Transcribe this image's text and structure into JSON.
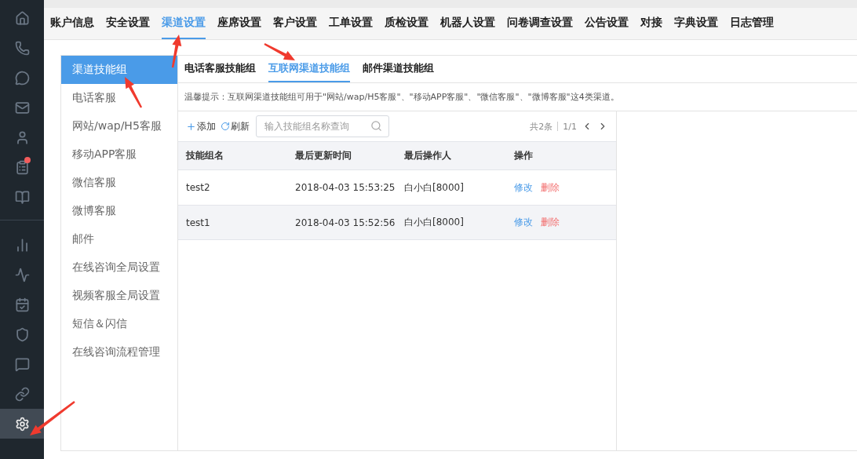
{
  "sidebar": {
    "top_items": [
      {
        "selected": false,
        "badge": false
      },
      {
        "selected": false,
        "badge": false
      },
      {
        "selected": false,
        "badge": false
      },
      {
        "selected": false,
        "badge": false
      },
      {
        "selected": false,
        "badge": false
      },
      {
        "selected": false,
        "badge": true
      },
      {
        "selected": false,
        "badge": false
      }
    ],
    "bottom_items": [
      {
        "selected": false,
        "badge": false
      },
      {
        "selected": false,
        "badge": false
      },
      {
        "selected": false,
        "badge": false
      },
      {
        "selected": false,
        "badge": false
      },
      {
        "selected": false,
        "badge": false
      },
      {
        "selected": false,
        "badge": false
      },
      {
        "selected": true,
        "badge": false
      }
    ]
  },
  "tabs": [
    {
      "label": "账户信息",
      "selected": false
    },
    {
      "label": "安全设置",
      "selected": false
    },
    {
      "label": "渠道设置",
      "selected": true
    },
    {
      "label": "座席设置",
      "selected": false
    },
    {
      "label": "客户设置",
      "selected": false
    },
    {
      "label": "工单设置",
      "selected": false
    },
    {
      "label": "质检设置",
      "selected": false
    },
    {
      "label": "机器人设置",
      "selected": false
    },
    {
      "label": "问卷调查设置",
      "selected": false
    },
    {
      "label": "公告设置",
      "selected": false
    },
    {
      "label": "对接",
      "selected": false
    },
    {
      "label": "字典设置",
      "selected": false
    },
    {
      "label": "日志管理",
      "selected": false
    }
  ],
  "menu": [
    {
      "label": "渠道技能组",
      "selected": true
    },
    {
      "label": "电话客服",
      "selected": false
    },
    {
      "label": "网站/wap/H5客服",
      "selected": false
    },
    {
      "label": "移动APP客服",
      "selected": false
    },
    {
      "label": "微信客服",
      "selected": false
    },
    {
      "label": "微博客服",
      "selected": false
    },
    {
      "label": "邮件",
      "selected": false
    },
    {
      "label": "在线咨询全局设置",
      "selected": false
    },
    {
      "label": "视频客服全局设置",
      "selected": false
    },
    {
      "label": "短信＆闪信",
      "selected": false
    },
    {
      "label": "在线咨询流程管理",
      "selected": false
    }
  ],
  "sub_tabs": [
    {
      "label": "电话客服技能组",
      "selected": false
    },
    {
      "label": "互联网渠道技能组",
      "selected": true
    },
    {
      "label": "邮件渠道技能组",
      "selected": false
    }
  ],
  "tip": "温馨提示：互联网渠道技能组可用于\"网站/wap/H5客服\"、\"移动APP客服\"、\"微信客服\"、\"微博客服\"这4类渠道。",
  "toolbar": {
    "add": "添加",
    "refresh": "刷新",
    "search": {
      "placeholder": "输入技能组名称查询"
    },
    "total": "共2条",
    "page": "1/1"
  },
  "table": {
    "columns": [
      "技能组名",
      "最后更新时间",
      "最后操作人",
      "操作"
    ],
    "rows": [
      {
        "name": "test2",
        "updated": "2018-04-03 15:53:25",
        "operator": "白小白[8000]",
        "edit": "修改",
        "delete": "删除",
        "selected": false
      },
      {
        "name": "test1",
        "updated": "2018-04-03 15:52:56",
        "operator": "白小白[8000]",
        "edit": "修改",
        "delete": "删除",
        "selected": true
      }
    ]
  }
}
